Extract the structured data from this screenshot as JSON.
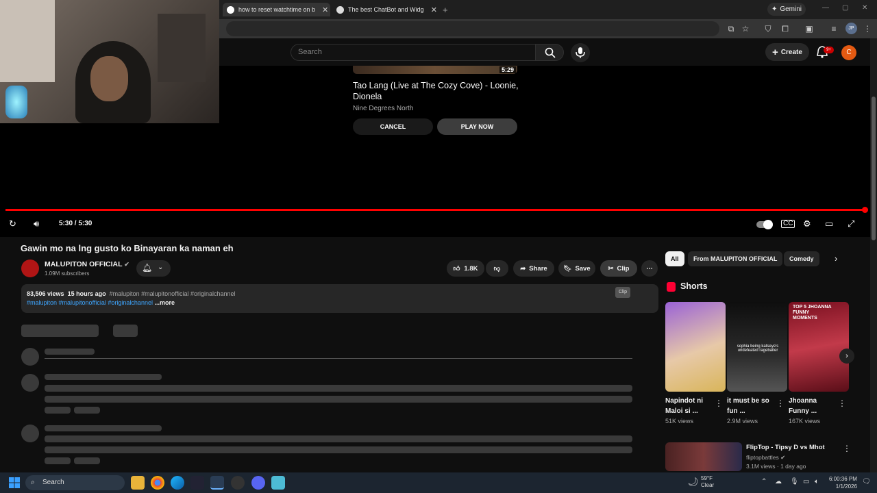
{
  "browser": {
    "tabs": [
      {
        "title": "how to reset watchtime on bot",
        "active": true
      },
      {
        "title": "The best ChatBot and Widgets",
        "active": false
      }
    ],
    "new_tab_symbol": "+",
    "gemini_label": "Gemini",
    "profile_initials": "JP"
  },
  "youtube": {
    "search_placeholder": "Search",
    "create_label": "Create",
    "notification_badge": "9+",
    "avatar_letter": "C"
  },
  "player": {
    "up_next": {
      "title": "Tao Lang (Live at The Cozy Cove) - Loonie, Dionela",
      "channel": "Nine Degrees North",
      "duration": "5:29",
      "cancel_label": "CANCEL",
      "play_now_label": "PLAY NOW"
    },
    "time": "5:30 / 5:30",
    "progress": 1.0
  },
  "video": {
    "title": "Gawin mo na lng gusto ko Binayaran ka naman eh",
    "channel_name": "MALUPITON OFFICIAL",
    "subscribers": "1.09M subscribers",
    "likes": "1.8K",
    "share_label": "Share",
    "save_label": "Save",
    "clip_label": "Clip",
    "clip_tooltip": "Clip",
    "views": "83,506 views",
    "posted": "15 hours ago",
    "hashtags_line1": "#malupiton #malupitonofficial #originalchannel",
    "hashtags_line2": "#malupiton #malupitonofficial #originalchannel",
    "more_label": "...more"
  },
  "sidebar": {
    "chips": [
      "All",
      "From MALUPITON OFFICIAL",
      "Comedy"
    ],
    "shorts_heading": "Shorts",
    "shorts": [
      {
        "title": "Napindot ni Maloi si ...",
        "views": "51K views"
      },
      {
        "title": "it must be so fun ...",
        "views": "2.9M views"
      },
      {
        "title": "Jhoanna Funny ...",
        "views": "167K views"
      }
    ],
    "short2_caption": "sophia being katseye's undefeated ragebaiter",
    "short3_caption": "TOP 5 JHOANNA FUNNY MOMENTS",
    "recommended": {
      "title": "FlipTop - Tipsy D vs Mhot",
      "channel": "fliptopbattles",
      "meta": "3.1M views · 1 day ago"
    }
  },
  "taskbar": {
    "search_label": "Search",
    "weather_temp": "59°F",
    "weather_desc": "Clear",
    "time": "6:00:36 PM",
    "date": "1/1/2026"
  },
  "colors": {
    "accent_red": "#ff0000",
    "link_blue": "#3ea6ff",
    "avatar_orange": "#e45a12"
  }
}
